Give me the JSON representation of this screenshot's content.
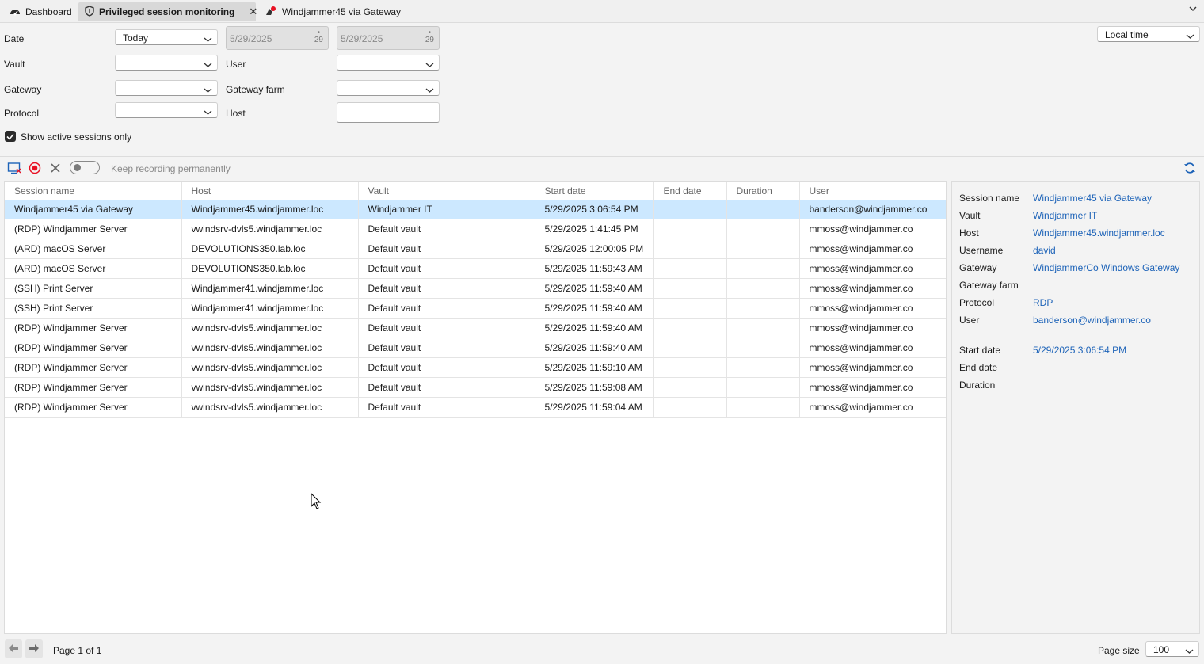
{
  "tabs": [
    {
      "label": "Dashboard",
      "icon": "dashboard-icon"
    },
    {
      "label": "Privileged session monitoring",
      "icon": "shield-icon",
      "active": true
    },
    {
      "label": "Windjammer45 via Gateway",
      "icon": "remote-session-icon"
    }
  ],
  "filters": {
    "date_label": "Date",
    "date_value": "Today",
    "date_from": "5/29/2025",
    "date_to": "5/29/2025",
    "calendar_day": "29",
    "timezone_value": "Local time",
    "vault_label": "Vault",
    "vault_value": "",
    "user_label": "User",
    "user_value": "",
    "gateway_label": "Gateway",
    "gateway_value": "",
    "gateway_farm_label": "Gateway farm",
    "gateway_farm_value": "",
    "protocol_label": "Protocol",
    "protocol_value": "",
    "host_label": "Host",
    "host_value": "",
    "active_only_label": "Show active sessions only",
    "active_only_checked": true
  },
  "toolbar": {
    "keep_recording_label": "Keep recording permanently"
  },
  "grid": {
    "columns": [
      "Session name",
      "Host",
      "Vault",
      "Start date",
      "End date",
      "Duration",
      "User"
    ],
    "rows": [
      {
        "name": "Windjammer45 via Gateway",
        "host": "Windjammer45.windjammer.loc",
        "vault": "Windjammer IT",
        "start": "5/29/2025 3:06:54 PM",
        "end": "",
        "duration": "",
        "user": "banderson@windjammer.co",
        "selected": true
      },
      {
        "name": "(RDP) Windjammer Server",
        "host": "vwindsrv-dvls5.windjammer.loc",
        "vault": "Default vault",
        "start": "5/29/2025 1:41:45 PM",
        "end": "",
        "duration": "",
        "user": "mmoss@windjammer.co"
      },
      {
        "name": "(ARD) macOS Server",
        "host": "DEVOLUTIONS350.lab.loc",
        "vault": "Default vault",
        "start": "5/29/2025 12:00:05 PM",
        "end": "",
        "duration": "",
        "user": "mmoss@windjammer.co"
      },
      {
        "name": "(ARD) macOS Server",
        "host": "DEVOLUTIONS350.lab.loc",
        "vault": "Default vault",
        "start": "5/29/2025 11:59:43 AM",
        "end": "",
        "duration": "",
        "user": "mmoss@windjammer.co"
      },
      {
        "name": "(SSH) Print Server",
        "host": "Windjammer41.windjammer.loc",
        "vault": "Default vault",
        "start": "5/29/2025 11:59:40 AM",
        "end": "",
        "duration": "",
        "user": "mmoss@windjammer.co"
      },
      {
        "name": "(SSH) Print Server",
        "host": "Windjammer41.windjammer.loc",
        "vault": "Default vault",
        "start": "5/29/2025 11:59:40 AM",
        "end": "",
        "duration": "",
        "user": "mmoss@windjammer.co"
      },
      {
        "name": "(RDP) Windjammer Server",
        "host": "vwindsrv-dvls5.windjammer.loc",
        "vault": "Default vault",
        "start": "5/29/2025 11:59:40 AM",
        "end": "",
        "duration": "",
        "user": "mmoss@windjammer.co"
      },
      {
        "name": "(RDP) Windjammer Server",
        "host": "vwindsrv-dvls5.windjammer.loc",
        "vault": "Default vault",
        "start": "5/29/2025 11:59:40 AM",
        "end": "",
        "duration": "",
        "user": "mmoss@windjammer.co"
      },
      {
        "name": "(RDP) Windjammer Server",
        "host": "vwindsrv-dvls5.windjammer.loc",
        "vault": "Default vault",
        "start": "5/29/2025 11:59:10 AM",
        "end": "",
        "duration": "",
        "user": "mmoss@windjammer.co"
      },
      {
        "name": "(RDP) Windjammer Server",
        "host": "vwindsrv-dvls5.windjammer.loc",
        "vault": "Default vault",
        "start": "5/29/2025 11:59:08 AM",
        "end": "",
        "duration": "",
        "user": "mmoss@windjammer.co"
      },
      {
        "name": "(RDP) Windjammer Server",
        "host": "vwindsrv-dvls5.windjammer.loc",
        "vault": "Default vault",
        "start": "5/29/2025 11:59:04 AM",
        "end": "",
        "duration": "",
        "user": "mmoss@windjammer.co"
      }
    ]
  },
  "details": {
    "fields": [
      {
        "label": "Session name",
        "value": "Windjammer45 via Gateway"
      },
      {
        "label": "Vault",
        "value": "Windjammer IT"
      },
      {
        "label": "Host",
        "value": "Windjammer45.windjammer.loc"
      },
      {
        "label": "Username",
        "value": "david"
      },
      {
        "label": "Gateway",
        "value": "WindjammerCo Windows Gateway"
      },
      {
        "label": "Gateway farm",
        "value": ""
      },
      {
        "label": "Protocol",
        "value": "RDP"
      },
      {
        "label": "User",
        "value": "banderson@windjammer.co"
      },
      {
        "label": "Start date",
        "value": "5/29/2025 3:06:54 PM"
      },
      {
        "label": "End date",
        "value": ""
      },
      {
        "label": "Duration",
        "value": ""
      }
    ]
  },
  "footer": {
    "page_text": "Page 1 of 1",
    "page_size_label": "Page size",
    "page_size_value": "100"
  },
  "colors": {
    "accent": "#1d63b8",
    "selected_row": "#cce8ff",
    "record_red": "#e81123"
  }
}
